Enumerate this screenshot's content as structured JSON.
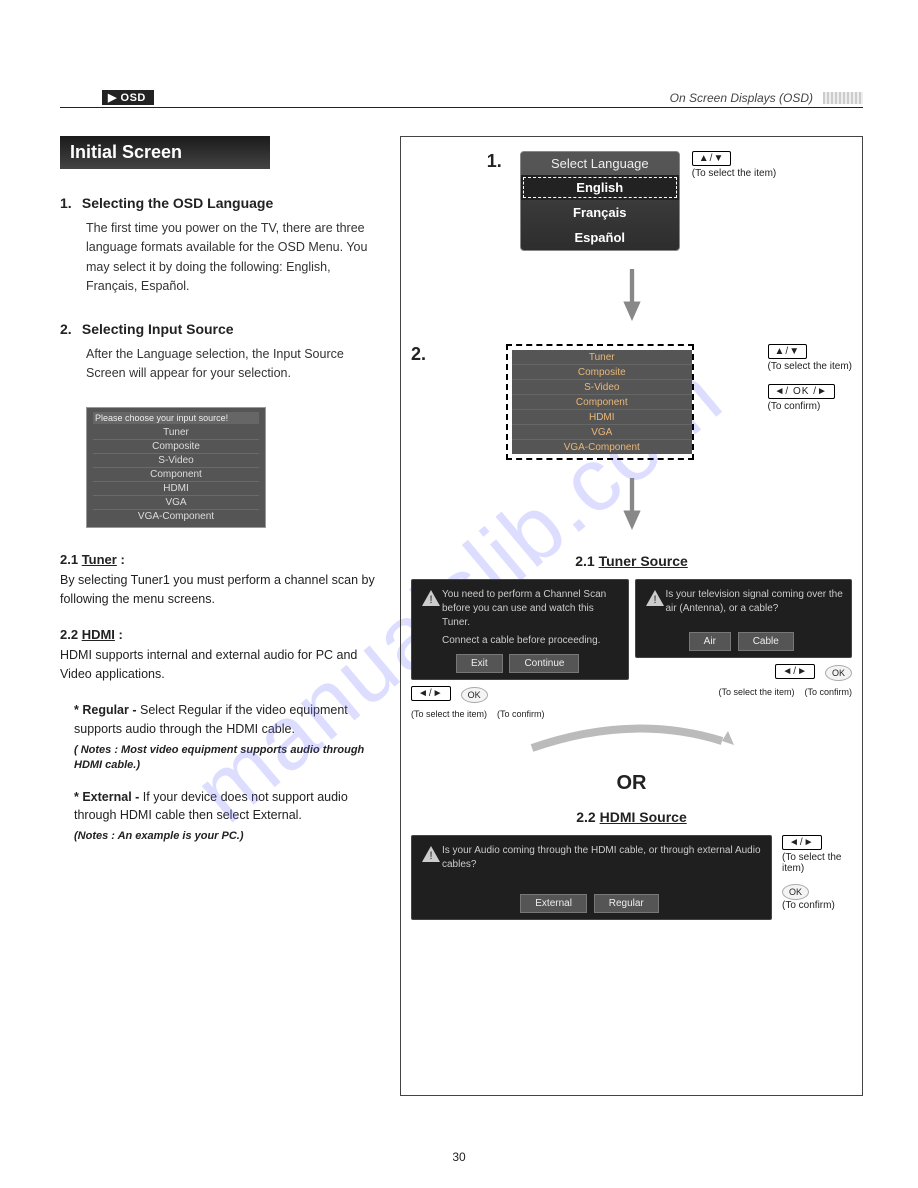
{
  "header": {
    "tab": "▶ OSD",
    "right": "On Screen Displays (OSD)"
  },
  "banner": "Initial Screen",
  "sec1": {
    "num": "1.",
    "title": "Selecting the OSD Language",
    "body": "The first time you power on the TV, there are three language formats available for the OSD Menu. You may select it by doing the following: English, Français, Español."
  },
  "sec2": {
    "num": "2.",
    "title": "Selecting Input Source",
    "body": "After the Language selection, the Input Source Screen will appear for your selection."
  },
  "panel": {
    "title": "Please choose your input source!",
    "items": [
      "Tuner",
      "Composite",
      "S-Video",
      "Component",
      "HDMI",
      "VGA",
      "VGA-Component"
    ]
  },
  "sub21": {
    "h": "2.1 Tuner :",
    "txt": "By selecting Tuner1 you must perform a channel scan by following the menu screens."
  },
  "sub22": {
    "h": "2.2 HDMI :",
    "txt": "HDMI supports internal and external audio for PC and Video applications.",
    "reg_lead": "* Regular - ",
    "reg": "Select Regular if the video equipment supports audio through the HDMI cable.",
    "reg_note": "( Notes : Most video equipment supports audio through HDMI cable.)",
    "ext_lead": "* External - ",
    "ext": "If your device does not support audio through HDMI cable then select External.",
    "ext_note": "(Notes : An example is your PC.)"
  },
  "step1": {
    "n": "1.",
    "title": "Select Language",
    "opts": [
      "English",
      "Français",
      "Español"
    ],
    "key": "▲/▼",
    "hint": "(To select the item)"
  },
  "step2": {
    "n": "2.",
    "items": [
      "Tuner",
      "Composite",
      "S-Video",
      "Component",
      "HDMI",
      "VGA",
      "VGA-Component"
    ],
    "key1": "▲/▼",
    "hint1": "(To select the item)",
    "key2": "◄/ OK /►",
    "hint2": "(To confirm)"
  },
  "tuner": {
    "title": "2.1 Tuner Source",
    "shotA": {
      "line1": "You need to perform a Channel Scan before you can use and watch this Tuner.",
      "line2": "Connect a cable before proceeding.",
      "btn1": "Exit",
      "btn2": "Continue"
    },
    "shotB": {
      "line1": "Is your television signal coming over the air (Antenna), or a cable?",
      "btn1": "Air",
      "btn2": "Cable"
    },
    "keyL": "◄/►",
    "okL": "OK",
    "hintL1": "(To select the item)",
    "hintL2": "(To confirm)",
    "keyR": "◄/►",
    "okR": "OK",
    "hintR1": "(To select the item)",
    "hintR2": "(To confirm)"
  },
  "or": "OR",
  "hdmi": {
    "title": "2.2 HDMI Source",
    "msg": "Is your Audio coming through the HDMI cable, or through external Audio cables?",
    "btn1": "External",
    "btn2": "Regular",
    "key": "◄/►",
    "ok": "OK",
    "hint1": "(To select the item)",
    "hint2": "(To confirm)"
  },
  "page": "30",
  "watermark": "manualslib.com"
}
